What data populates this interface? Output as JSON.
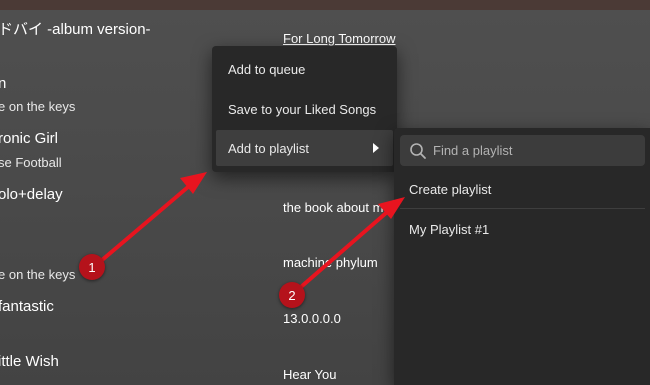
{
  "header": {
    "now_playing_title": "ドバイ -album version-"
  },
  "left_tracks": [
    {
      "name": "left-track-1",
      "text": "n"
    },
    {
      "name": "left-track-2",
      "text": "e on the keys"
    },
    {
      "name": "left-track-3",
      "text": "ronic Girl"
    },
    {
      "name": "left-track-4",
      "text": "se Football"
    },
    {
      "name": "left-track-5",
      "text": "olo+delay"
    },
    {
      "name": "left-track-6",
      "text": "e on the keys"
    },
    {
      "name": "left-track-7",
      "text": "fantastic"
    },
    {
      "name": "left-track-8",
      "text": "ittle Wish"
    }
  ],
  "right_tracks": [
    {
      "text": "For Long Tomorrow"
    },
    {
      "text": "the book about m"
    },
    {
      "text": "machine phylum"
    },
    {
      "text": "13.0.0.0.0"
    },
    {
      "text": "Hear You"
    }
  ],
  "context_menu": {
    "items": [
      {
        "label": "Add to queue"
      },
      {
        "label": "Save to your Liked Songs"
      },
      {
        "label": "Add to playlist"
      }
    ]
  },
  "playlist_submenu": {
    "search_placeholder": "Find a playlist",
    "create_label": "Create playlist",
    "playlists": [
      {
        "label": "My Playlist #1"
      }
    ]
  },
  "annotations": {
    "badge_1": "1",
    "badge_2": "2",
    "accent_color": "#b5121b",
    "arrow_color": "#e8141f"
  }
}
